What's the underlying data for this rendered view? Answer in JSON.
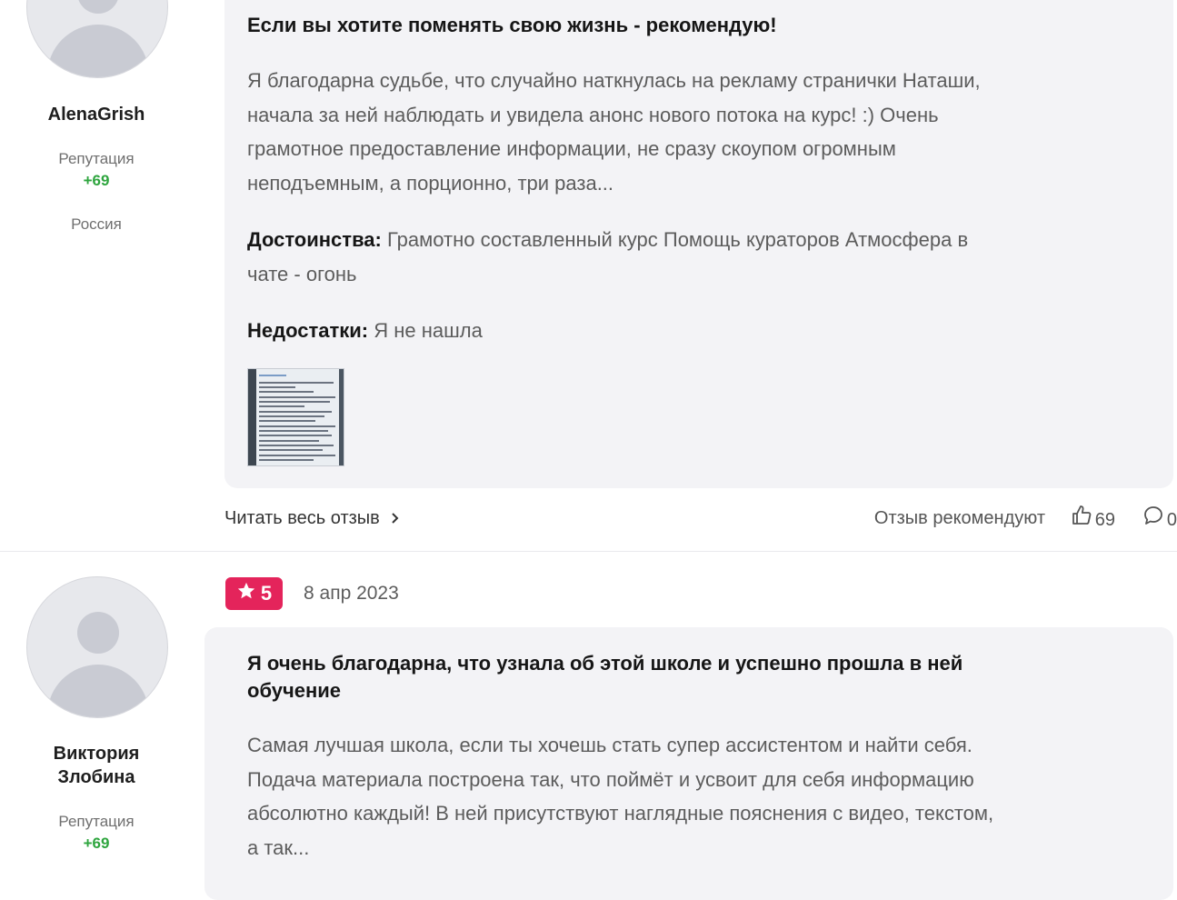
{
  "review1": {
    "author": {
      "name": "AlenaGrish",
      "reputation_label": "Репутация",
      "reputation_value": "+69",
      "country": "Россия"
    },
    "title": "Если вы хотите поменять свою жизнь - рекомендую!",
    "text_lines": [
      "Я благодарна судьбе, что случайно наткнулась на рекламу странички Наташи,",
      "начала за ней наблюдать и увидела анонс нового потока на курс! :) Очень",
      "грамотное предоставление информации, не сразу скоупом огромным",
      "неподъемным, а порционно, три раза..."
    ],
    "pros_label": "Достоинства:",
    "pros_line1": "Грамотно составленный курс Помощь кураторов Атмосфера в",
    "pros_line2": "чате - огонь",
    "cons_label": "Недостатки:",
    "cons_text": "Я не нашла",
    "read_more": "Читать весь отзыв",
    "recommend_label": "Отзыв рекомендуют",
    "likes": "69",
    "comments": "0"
  },
  "review2": {
    "rating": "5",
    "date": "8 апр 2023",
    "author": {
      "name_line1": "Виктория",
      "name_line2": "Злобина",
      "reputation_label": "Репутация",
      "reputation_value": "+69"
    },
    "title_line1": "Я очень благодарна, что узнала об этой школе и успешно прошла в ней",
    "title_line2": "обучение",
    "text_lines": [
      "Самая лучшая школа, если ты хочешь стать супер ассистентом и найти себя.",
      "Подача материала построена так, что поймёт и усвоит для себя информацию",
      "абсолютно каждый! В ней присутствуют наглядные пояснения с видео, текстом,",
      "а так..."
    ]
  },
  "icons": {
    "chevron": "chevron-right-icon",
    "like": "thumbs-up-icon",
    "comment": "comment-icon",
    "star": "star-icon"
  },
  "colors": {
    "rating_badge": "#e4245b",
    "reputation_positive": "#2ea53e",
    "card_background": "#f3f3f6"
  }
}
